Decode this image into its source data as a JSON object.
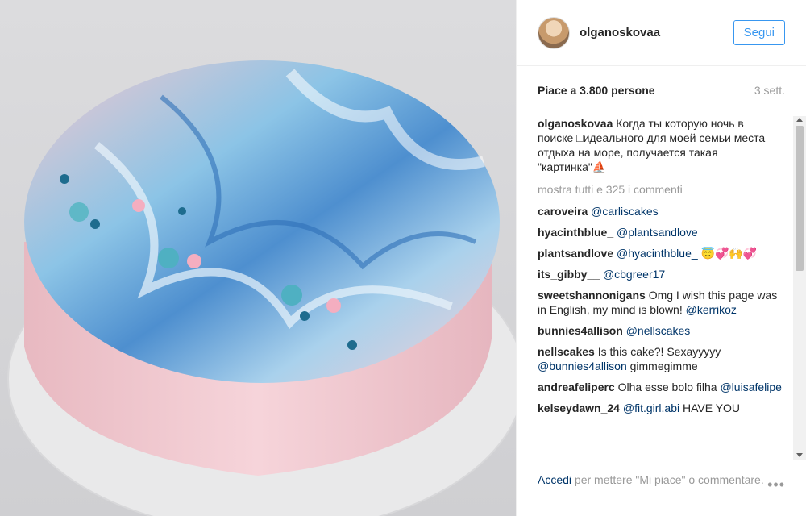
{
  "post": {
    "username": "olganoskovaa",
    "follow_label": "Segui",
    "likes": "Piace a 3.800 persone",
    "time": "3 sett."
  },
  "caption": {
    "username": "olganoskovaa",
    "text": "Когда ты которую ночь в поиске □идеального для моей семьи места отдыха на море, получается такая \"картинка\"⛵"
  },
  "show_all": "mostra tutti e 325 i commenti",
  "comments": [
    {
      "user": "caroveira",
      "mention": "@carliscakes",
      "text": ""
    },
    {
      "user": "hyacinthblue_",
      "mention": "@plantsandlove",
      "text": ""
    },
    {
      "user": "plantsandlove",
      "mention": "@hyacinthblue_",
      "text": "😇💞🙌💞"
    },
    {
      "user": "its_gibby__",
      "mention": "@cbgreer17",
      "text": ""
    },
    {
      "user": "sweetshannonigans",
      "pre": "Omg I wish this page was in English, my mind is blown!",
      "mention": "@kerrikoz",
      "text": ""
    },
    {
      "user": "bunnies4allison",
      "mention": "@nellscakes",
      "text": ""
    },
    {
      "user": "nellscakes",
      "pre": "Is this cake?! Sexayyyyy",
      "mention": "@bunnies4allison",
      "text": "gimmegimme"
    },
    {
      "user": "andreafeliperc",
      "pre": "Olha esse bolo filha",
      "mention": "@luisafelipe",
      "text": ""
    },
    {
      "user": "kelseydawn_24",
      "mention": "@fit.girl.abi",
      "text": "HAVE YOU"
    }
  ],
  "footer": {
    "login": "Accedi",
    "rest": " per mettere \"Mi piace\" o commentare.",
    "more": "•••"
  }
}
